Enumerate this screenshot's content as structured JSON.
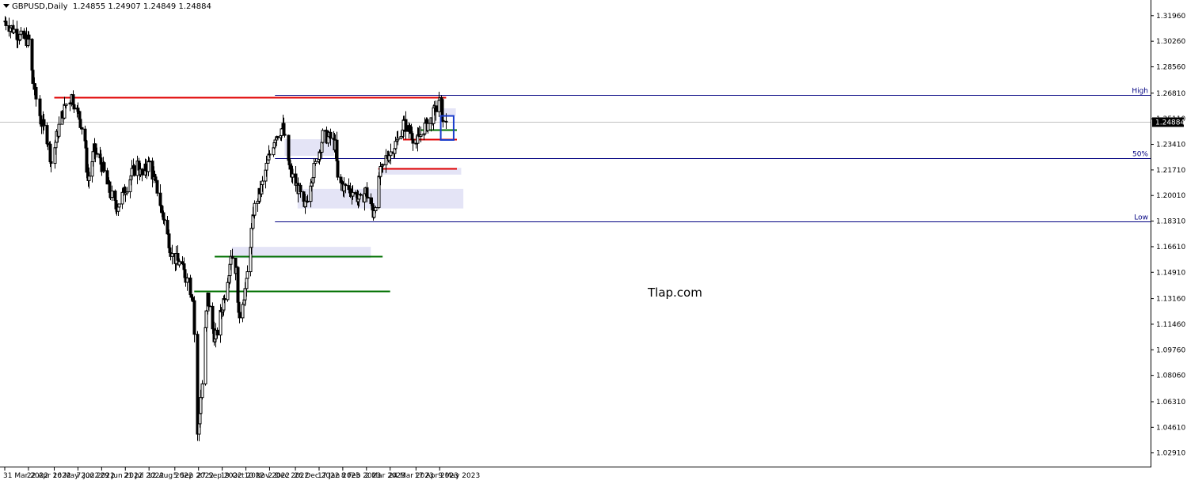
{
  "header": {
    "symbol": "GBPUSD,Daily",
    "ohlc": "1.24855 1.24907 1.24849 1.24884"
  },
  "watermark": "Tlap.com",
  "colors": {
    "background": "#ffffff",
    "candle": "#000000",
    "resistance": "#e00000",
    "support": "#007000",
    "fib": "#000080",
    "zone": "#e4e4f6",
    "box": "#1a3ccc",
    "current_price_line": "#c0c0c0"
  },
  "chart_data": {
    "type": "candlestick",
    "symbol": "GBPUSD",
    "timeframe": "Daily",
    "ylim": [
      1.02,
      1.33
    ],
    "y_ticks": [
      "1.31960",
      "1.30260",
      "1.28560",
      "1.26810",
      "1.25110",
      "1.23410",
      "1.21710",
      "1.20010",
      "1.18310",
      "1.16610",
      "1.14910",
      "1.13160",
      "1.11460",
      "1.09760",
      "1.08060",
      "1.06310",
      "1.04610",
      "1.02910"
    ],
    "x_ticks": [
      "31 Mar 2022",
      "22 Apr 2022",
      "16 May 2022",
      "7 Jun 2022",
      "29 Jun 2022",
      "21 Jul 2022",
      "12 Aug 2022",
      "5 Sep 2022",
      "27 Sep 2022",
      "19 Oct 2022",
      "10 Nov 2022",
      "2 Dec 2022",
      "26 Dec 2022",
      "17 Jan 2023",
      "8 Feb 2023",
      "2 Mar 2023",
      "24 Mar 2023",
      "17 Apr 2023",
      "9 May 2023"
    ],
    "current_price": "1.24884",
    "price_path": [
      [
        "2022-03-31",
        1.316
      ],
      [
        "2022-04-08",
        1.31
      ],
      [
        "2022-04-15",
        1.305
      ],
      [
        "2022-04-22",
        1.303
      ],
      [
        "2022-04-26",
        1.275
      ],
      [
        "2022-05-03",
        1.25
      ],
      [
        "2022-05-10",
        1.237
      ],
      [
        "2022-05-13",
        1.222
      ],
      [
        "2022-05-20",
        1.246
      ],
      [
        "2022-05-26",
        1.26
      ],
      [
        "2022-06-01",
        1.266
      ],
      [
        "2022-06-08",
        1.252
      ],
      [
        "2022-06-13",
        1.237
      ],
      [
        "2022-06-16",
        1.21
      ],
      [
        "2022-06-22",
        1.23
      ],
      [
        "2022-06-29",
        1.22
      ],
      [
        "2022-07-05",
        1.205
      ],
      [
        "2022-07-12",
        1.192
      ],
      [
        "2022-07-18",
        1.2
      ],
      [
        "2022-07-25",
        1.212
      ],
      [
        "2022-08-01",
        1.221
      ],
      [
        "2022-08-05",
        1.213
      ],
      [
        "2022-08-12",
        1.222
      ],
      [
        "2022-08-19",
        1.204
      ],
      [
        "2022-08-26",
        1.183
      ],
      [
        "2022-09-02",
        1.16
      ],
      [
        "2022-09-09",
        1.155
      ],
      [
        "2022-09-16",
        1.145
      ],
      [
        "2022-09-22",
        1.131
      ],
      [
        "2022-09-26",
        1.04
      ],
      [
        "2022-09-30",
        1.075
      ],
      [
        "2022-10-05",
        1.133
      ],
      [
        "2022-10-12",
        1.103
      ],
      [
        "2022-10-19",
        1.127
      ],
      [
        "2022-10-24",
        1.146
      ],
      [
        "2022-10-27",
        1.162
      ],
      [
        "2022-11-01",
        1.149
      ],
      [
        "2022-11-03",
        1.118
      ],
      [
        "2022-11-10",
        1.141
      ],
      [
        "2022-11-17",
        1.19
      ],
      [
        "2022-11-24",
        1.205
      ],
      [
        "2022-12-01",
        1.225
      ],
      [
        "2022-12-07",
        1.24
      ],
      [
        "2022-12-14",
        1.245
      ],
      [
        "2022-12-21",
        1.215
      ],
      [
        "2022-12-28",
        1.205
      ],
      [
        "2023-01-03",
        1.19
      ],
      [
        "2023-01-10",
        1.213
      ],
      [
        "2023-01-17",
        1.23
      ],
      [
        "2023-01-20",
        1.24
      ],
      [
        "2023-01-27",
        1.238
      ],
      [
        "2023-02-01",
        1.233
      ],
      [
        "2023-02-03",
        1.21
      ],
      [
        "2023-02-10",
        1.205
      ],
      [
        "2023-02-17",
        1.203
      ],
      [
        "2023-02-24",
        1.196
      ],
      [
        "2023-03-01",
        1.203
      ],
      [
        "2023-03-08",
        1.188
      ],
      [
        "2023-03-14",
        1.213
      ],
      [
        "2023-03-20",
        1.225
      ],
      [
        "2023-03-24",
        1.229
      ],
      [
        "2023-03-31",
        1.237
      ],
      [
        "2023-04-05",
        1.248
      ],
      [
        "2023-04-12",
        1.242
      ],
      [
        "2023-04-17",
        1.235
      ],
      [
        "2023-04-24",
        1.245
      ],
      [
        "2023-05-01",
        1.25
      ],
      [
        "2023-05-08",
        1.264
      ],
      [
        "2023-05-10",
        1.26
      ],
      [
        "2023-05-12",
        1.247
      ],
      [
        "2023-05-15",
        1.249
      ]
    ],
    "horizontal_levels": [
      {
        "label": "High",
        "value": 1.267,
        "color": "fib"
      },
      {
        "label": "50%",
        "value": 1.225,
        "color": "fib"
      },
      {
        "label": "Low",
        "value": 1.1828,
        "color": "fib"
      },
      {
        "label": "",
        "value": 1.2653,
        "color": "resistance",
        "start": "2022-05-16",
        "end": "2023-05-15"
      },
      {
        "label": "",
        "value": 1.2375,
        "color": "resistance",
        "start": "2023-04-05",
        "end": "2023-05-25"
      },
      {
        "label": "",
        "value": 1.218,
        "color": "resistance",
        "start": "2023-03-13",
        "end": "2023-05-25"
      },
      {
        "label": "",
        "value": 1.244,
        "color": "support",
        "start": "2023-04-21",
        "end": "2023-05-25"
      },
      {
        "label": "",
        "value": 1.16,
        "color": "support",
        "start": "2022-10-12",
        "end": "2023-03-17"
      },
      {
        "label": "",
        "value": 1.1365,
        "color": "support",
        "start": "2022-09-23",
        "end": "2023-03-24"
      }
    ],
    "zones": [
      {
        "from": 1.253,
        "to": 1.258,
        "start": "2023-05-12",
        "end": "2023-05-24"
      },
      {
        "from": 1.2265,
        "to": 1.2375,
        "start": "2022-12-16",
        "end": "2023-01-31"
      },
      {
        "from": 1.214,
        "to": 1.2185,
        "start": "2023-03-13",
        "end": "2023-05-29"
      },
      {
        "from": 1.1915,
        "to": 1.2045,
        "start": "2022-12-28",
        "end": "2023-05-31"
      },
      {
        "from": 1.1585,
        "to": 1.166,
        "start": "2022-10-28",
        "end": "2023-03-06"
      }
    ]
  }
}
